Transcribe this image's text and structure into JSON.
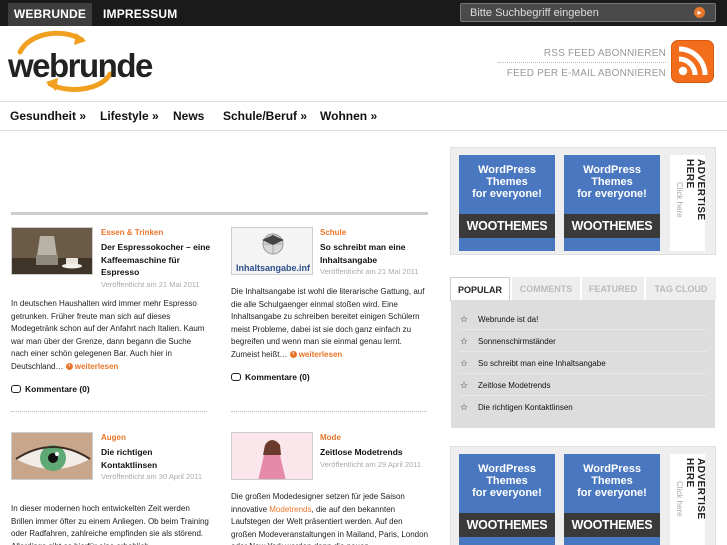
{
  "topbar": {
    "tabs": [
      "WEBRUNDE",
      "IMPRESSUM"
    ],
    "search_placeholder": "Bitte Suchbegriff eingeben"
  },
  "header": {
    "logo": "webrunde",
    "rss_link": "RSS FEED ABONNIEREN",
    "email_link": "FEED PER E-MAIL ABONNIEREN"
  },
  "nav": {
    "items": [
      "Gesundheit »",
      "Lifestyle »",
      "News",
      "Schule/Beruf »",
      "Wohnen »"
    ]
  },
  "posts": [
    {
      "category": "Essen & Trinken",
      "title": "Der Espressokocher – eine Kaffeemaschine für Espresso",
      "date": "Veröffentlicht am 21 Mai 2011",
      "body": "In deutschen Haushalten wird immer mehr Espresso getrunken. Früher freute man sich auf dieses Modegetränk schon auf der Anfahrt nach Italien. Kaum war man über der Grenze, dann begann die Suche nach einer schön gelegenen Bar. Auch hier in Deutschland…",
      "more": "weiterlesen",
      "comments": "Kommentare (0)"
    },
    {
      "category": "Schule",
      "title": "So schreibt man eine Inhaltsangabe",
      "date": "Veröffentlicht am 21 Mai 2011",
      "thumb_caption": "Inhaltsangabe.inf",
      "body": "Die Inhaltsangabe ist wohl die literarische Gattung, auf die alle Schulgaenger einmal stoßen wird. Eine Inhaltsangabe zu schreiben bereitet einigen Schülern meist Probleme, dabei ist sie doch ganz einfach zu begreifen und wenn man sie einmal genau lernt. Zumeist heißt…",
      "more": "weiterlesen",
      "comments": "Kommentare (0)"
    },
    {
      "category": "Augen",
      "title": "Die richtigen Kontaktlinsen",
      "date": "Veröffentlicht am 30 April 2011",
      "body": "In dieser modernen hoch entwickelten Zeit werden Brillen immer öfter zu einem Anliegen. Ob beim Training oder Radfahren, zahlreiche empfinden sie als störend. Allerdings gibt es hierfür eine erheblich"
    },
    {
      "category": "Mode",
      "title": "Zeitlose Modetrends",
      "date": "Veröffentlicht am 29 April 2011",
      "body_before_link": "Die großen Modedesigner setzen für jede Saison innovative ",
      "body_link": "Modetrends",
      "body_after_link": ", die auf den bekannten Laufstegen der Welt präsentiert werden. Auf den großen Modeveranstaltungen in Mailand, Paris, London oder New York werden dann die neuen"
    }
  ],
  "sidebar": {
    "ads": {
      "line1": "WordPress",
      "line2": "Themes",
      "line3": "for everyone!",
      "brand": "WOOTHEMES"
    },
    "advertise": {
      "main": "ADVERTISE HERE",
      "sub": "Click here"
    },
    "tabs": [
      "POPULAR",
      "COMMENTS",
      "FEATURED",
      "TAG CLOUD"
    ],
    "popular": [
      "Webrunde ist da!",
      "Sonnenschirmständer",
      "So schreibt man eine Inhaltsangabe",
      "Zeitlose Modetrends",
      "Die richtigen Kontaktlinsen"
    ]
  },
  "colors": {
    "accent": "#e8762b",
    "topbar": "#1a1a1a",
    "ad_blue": "#4a78c0"
  }
}
